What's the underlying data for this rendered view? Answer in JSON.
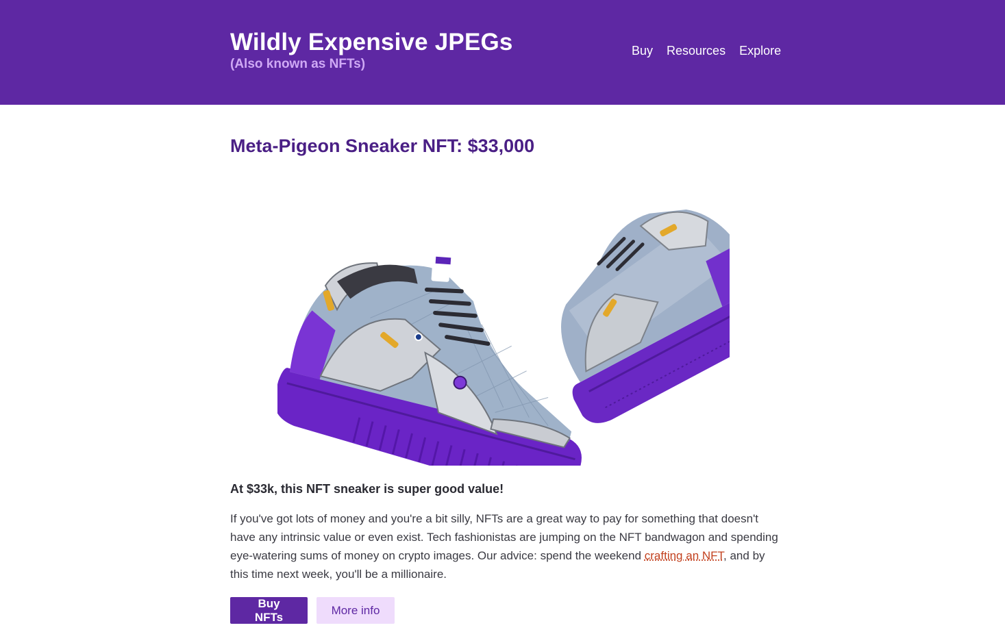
{
  "header": {
    "title": "Wildly Expensive JPEGs",
    "subtitle": "(Also known as NFTs)",
    "nav": [
      "Buy",
      "Resources",
      "Explore"
    ]
  },
  "product": {
    "title": "Meta-Pigeon Sneaker NFT: $33,000",
    "image_label": "sneaker-image",
    "tagline": "At $33k, this NFT sneaker is super good value!",
    "description_before_link": "If you've got lots of money and you're a bit silly, NFTs are a great way to pay for something that doesn't have any intrinsic value or even exist. Tech fashionistas are jumping on the NFT bandwagon and spending eye-watering sums of money on crypto images. Our advice: spend the weekend ",
    "description_link": "crafting an NFT",
    "description_after_link": ", and by this time next week, you'll be a millionaire."
  },
  "actions": {
    "primary_label": "Buy NFTs",
    "secondary_label": "More info"
  },
  "colors": {
    "brand_purple": "#5e28a3",
    "heading_purple": "#4a1f85",
    "subtitle_lilac": "#cfa9f5",
    "secondary_button_bg": "#efdcfc",
    "link_orange": "#c2411f"
  }
}
